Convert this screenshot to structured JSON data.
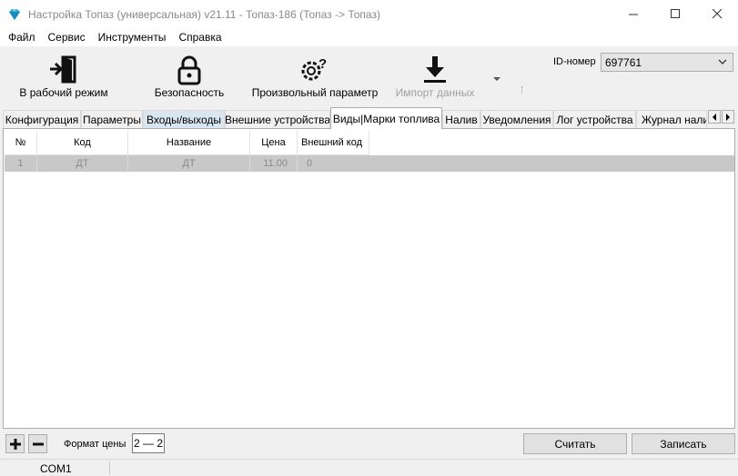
{
  "window": {
    "title": "Настройка Топаз (универсальная) v21.11 - Топаз-186 (Топаз -> Топаз)",
    "minimize": "—",
    "maximize": "☐",
    "close": "✕"
  },
  "menu": [
    "Файл",
    "Сервис",
    "Инструменты",
    "Справка"
  ],
  "toolbar": {
    "work_mode": "В рабочий режим",
    "security": "Безопасность",
    "custom_param": "Произвольный параметр",
    "import_data": "Импорт данных",
    "id_label": "ID-номер",
    "id_value": "697761"
  },
  "tabs": [
    "Конфигурация",
    "Параметры",
    "Входы/выходы",
    "Внешние устройства",
    "Виды|Марки топлива",
    "Налив",
    "Уведомления",
    "Лог устройства",
    "Журнал налива"
  ],
  "active_tab_index": 4,
  "highlight_tab_index": 2,
  "grid": {
    "columns": [
      "№",
      "Код",
      "Название",
      "Цена",
      "Внешний код"
    ],
    "rows": [
      {
        "num": "1",
        "code": "ДТ",
        "name": "ДТ",
        "price": "11.00",
        "ext": "0"
      }
    ]
  },
  "bottom": {
    "add": "+",
    "remove": "−",
    "price_format_label": "Формат цены",
    "price_format_value": "2 — 2",
    "read_button": "Считать",
    "write_button": "Записать"
  },
  "status": {
    "port": "COM1"
  },
  "colors": {
    "icon_accent": "#2aa8d8",
    "selected_row": "#c8c8c8",
    "highlight_tab": "#d8e6f2"
  }
}
